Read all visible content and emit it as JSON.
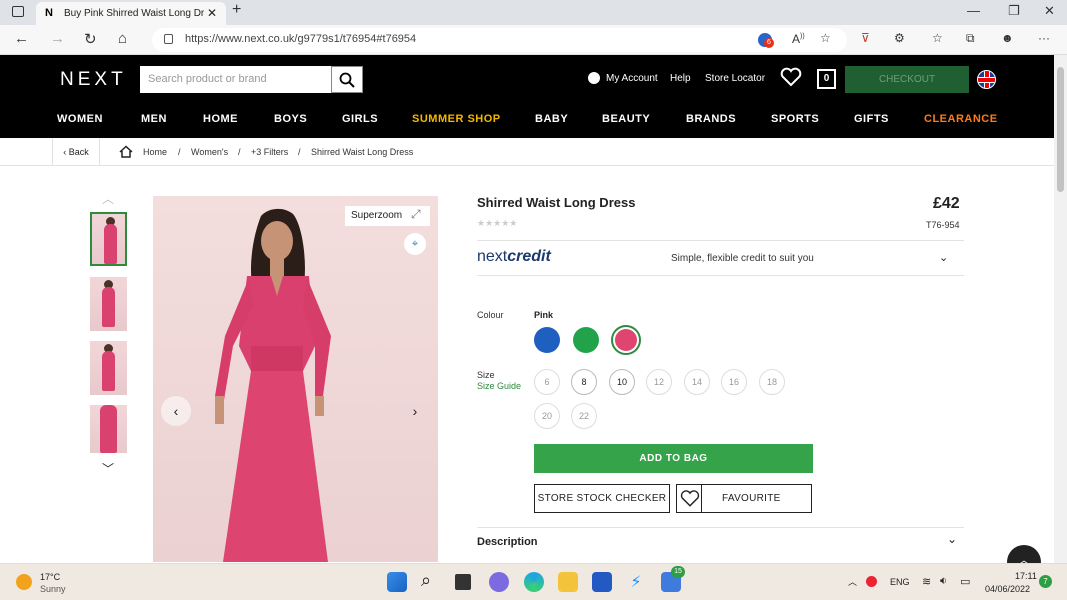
{
  "browser": {
    "tab_favicon": "N",
    "tab_title": "Buy Pink Shirred Waist Long Dress",
    "url": "https://www.next.co.uk/g9779s1/t76954#t76954",
    "extension_badge": "6"
  },
  "header": {
    "logo": "NEXT",
    "search_placeholder": "Search product or brand",
    "my_account": "My Account",
    "help": "Help",
    "store_locator": "Store Locator",
    "bag_count": "0",
    "checkout": "CHECKOUT"
  },
  "nav": {
    "items": [
      "WOMEN",
      "MEN",
      "HOME",
      "BOYS",
      "GIRLS",
      "SUMMER SHOP",
      "BABY",
      "BEAUTY",
      "BRANDS",
      "SPORTS",
      "GIFTS",
      "CLEARANCE"
    ],
    "highlight_color": "#f5b800",
    "clearance_color": "#ff7a1a"
  },
  "breadcrumb": {
    "back": "Back",
    "home": "Home",
    "sep": "/",
    "items": [
      "Women's",
      "+3 Filters",
      "Shirred Waist Long Dress"
    ]
  },
  "gallery": {
    "superzoom": "Superzoom"
  },
  "product": {
    "title": "Shirred Waist Long Dress",
    "price": "£42",
    "sku": "T76-954",
    "stars": "★★★★★",
    "credit_logo_a": "next",
    "credit_logo_b": "credit",
    "credit_text": "Simple, flexible credit to suit you",
    "colour_label": "Colour",
    "colour_selected": "Pink",
    "colours": [
      "#1f5fbf",
      "#22a24a",
      "#e0456f"
    ],
    "size_label": "Size",
    "size_guide": "Size Guide",
    "sizes": [
      "6",
      "8",
      "10",
      "12",
      "14",
      "16",
      "18",
      "20",
      "22"
    ],
    "add_to_bag": "ADD TO BAG",
    "store_stock": "STORE STOCK CHECKER",
    "favourite": "FAVOURITE",
    "description": "Description"
  },
  "taskbar": {
    "weather_temp": "17°C",
    "weather_text": "Sunny",
    "lang": "ENG",
    "time": "17:11",
    "date": "04/06/2022",
    "notif_count": "7",
    "mail_badge": "15"
  }
}
